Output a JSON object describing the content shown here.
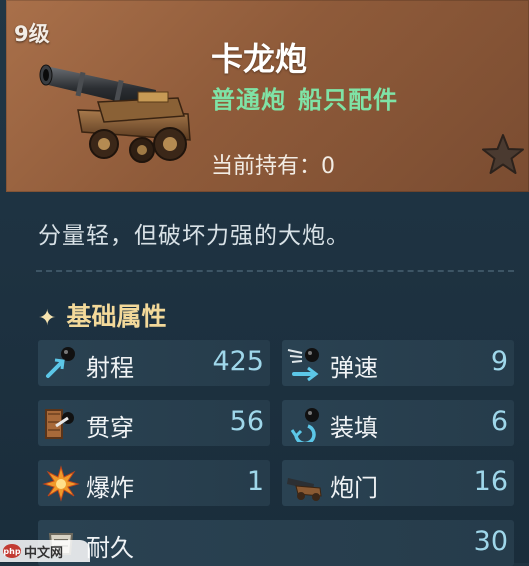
{
  "item": {
    "level": "9级",
    "name": "卡龙炮",
    "tags": [
      "普通炮",
      "船只配件"
    ],
    "holding_label": "当前持有：",
    "holding_count": "0",
    "favorite_icon": "star-icon",
    "description": "分量轻，但破坏力强的大炮。"
  },
  "attributes": {
    "section_title": "基础属性",
    "section_icon": "sparkle-icon",
    "stats": [
      {
        "label": "射程",
        "value": "425",
        "icon": "range-icon"
      },
      {
        "label": "弹速",
        "value": "9",
        "icon": "projectile-speed-icon"
      },
      {
        "label": "贯穿",
        "value": "56",
        "icon": "penetration-icon"
      },
      {
        "label": "装填",
        "value": "6",
        "icon": "reload-icon"
      },
      {
        "label": "爆炸",
        "value": "1",
        "icon": "explosion-icon"
      },
      {
        "label": "炮门",
        "value": "16",
        "icon": "cannon-port-icon"
      },
      {
        "label": "耐久",
        "value": "30",
        "icon": "durability-icon"
      }
    ]
  },
  "watermark": {
    "logo": "php",
    "text": "中文网"
  },
  "colors": {
    "header_bg": "#8f5b3a",
    "panel_bg": "#1f3341",
    "tag_green": "#7fe3a6",
    "stat_value": "#9fd7ea",
    "section_gold": "#f3d99a"
  }
}
